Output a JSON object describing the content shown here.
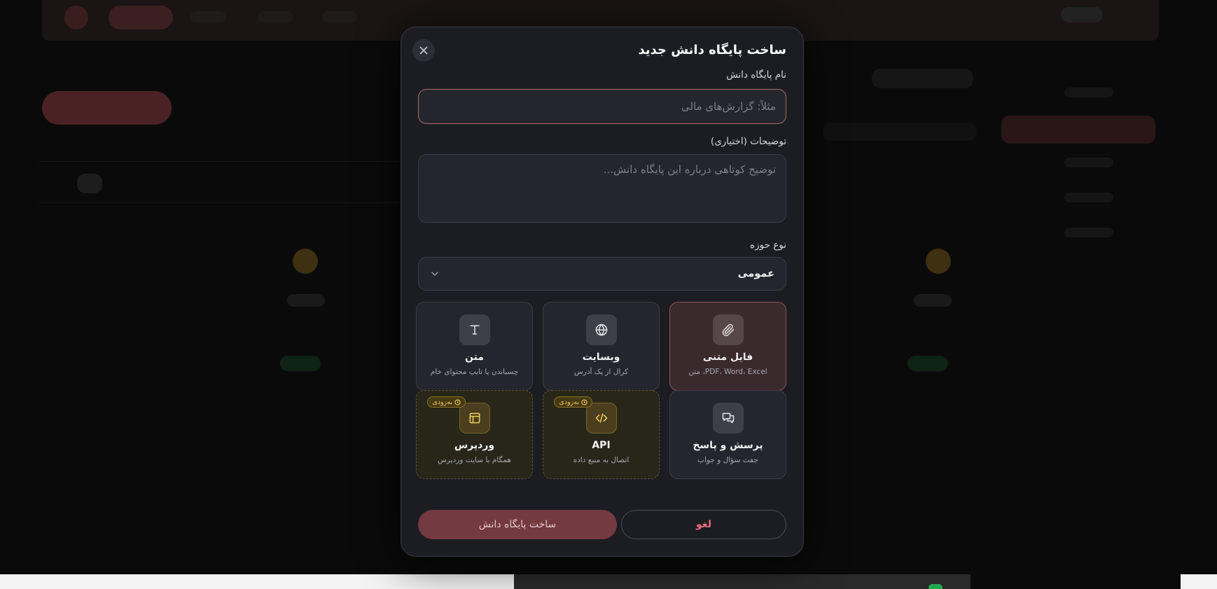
{
  "modal": {
    "title": "ساخت پایگاه دانش جدید",
    "name_label": "نام پایگاه دانش",
    "name_placeholder": "مثلاً: گزارش‌های مالی",
    "name_value": "",
    "desc_label": "توضیحات (اختیاری)",
    "desc_placeholder": "توضیح کوتاهی درباره این پایگاه دانش...",
    "domain_label": "نوع حوزه",
    "domain_value": "عمومی",
    "create_label": "ساخت پایگاه دانش",
    "cancel_label": "لغو",
    "soon_label": "به‌زودی"
  },
  "sources": [
    {
      "key": "file",
      "title": "فایل متنی",
      "subtitle": "PDF، Word، Excel، متن",
      "icon": "paperclip-icon",
      "state": "active"
    },
    {
      "key": "website",
      "title": "وبسایت",
      "subtitle": "کرال از یک آدرس",
      "icon": "globe-icon",
      "state": "normal"
    },
    {
      "key": "text",
      "title": "متن",
      "subtitle": "چسباندن یا تایپ محتوای خام",
      "icon": "text-icon",
      "state": "normal"
    },
    {
      "key": "qa",
      "title": "پرسش و پاسخ",
      "subtitle": "جفت سؤال و جواب",
      "icon": "chat-icon",
      "state": "normal"
    },
    {
      "key": "api",
      "title": "API",
      "subtitle": "اتصال به منبع داده",
      "icon": "code-icon",
      "state": "soon"
    },
    {
      "key": "wordpress",
      "title": "وردپرس",
      "subtitle": "همگام با سایت وردپرس",
      "icon": "layout-icon",
      "state": "soon"
    }
  ],
  "colors": {
    "accent": "#733a40",
    "danger_text": "#e86e78",
    "soon": "#f2cf5b",
    "modal_bg": "#1c1d23"
  }
}
